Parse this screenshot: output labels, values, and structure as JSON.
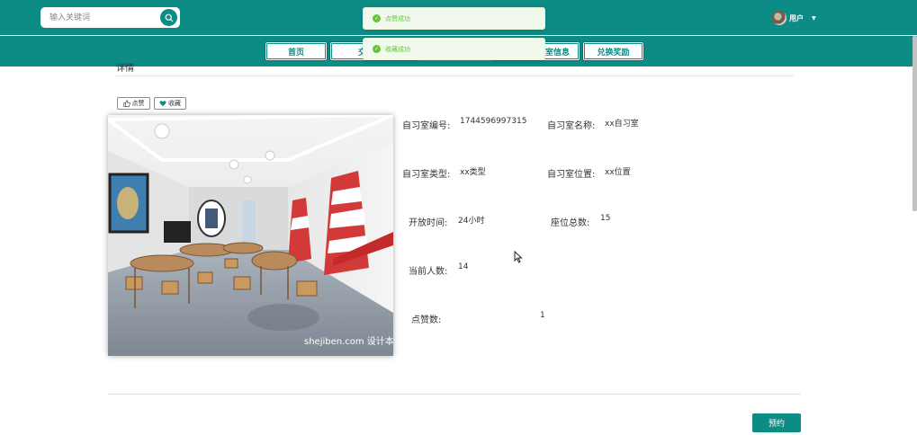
{
  "search": {
    "placeholder": "输入关键词"
  },
  "user": {
    "name": "用户"
  },
  "nav": {
    "items": [
      "首页",
      "交流论坛",
      "自习室信息",
      "兑换奖励"
    ]
  },
  "toasts": [
    "点赞成功",
    "收藏成功"
  ],
  "section": {
    "title": "详情"
  },
  "actions": {
    "like": "点赞",
    "favorite": "收藏"
  },
  "image": {
    "watermark": "shejiben.com 设计本"
  },
  "details": [
    {
      "label": "自习室编号:",
      "value": "1744596997315"
    },
    {
      "label": "自习室名称:",
      "value": "xx自习室"
    },
    {
      "label": "自习室类型:",
      "value": "xx类型"
    },
    {
      "label": "自习室位置:",
      "value": "xx位置"
    },
    {
      "label": "开放时间:",
      "value": "24小时"
    },
    {
      "label": "座位总数:",
      "value": "15"
    },
    {
      "label": "当前人数:",
      "value": "14"
    },
    {
      "label": "点赞数:",
      "value": "1"
    }
  ],
  "reserve": {
    "label": "预约"
  },
  "colors": {
    "primary": "#0d8b85",
    "success": "#67c23a",
    "toast_bg": "#f0f9eb"
  }
}
